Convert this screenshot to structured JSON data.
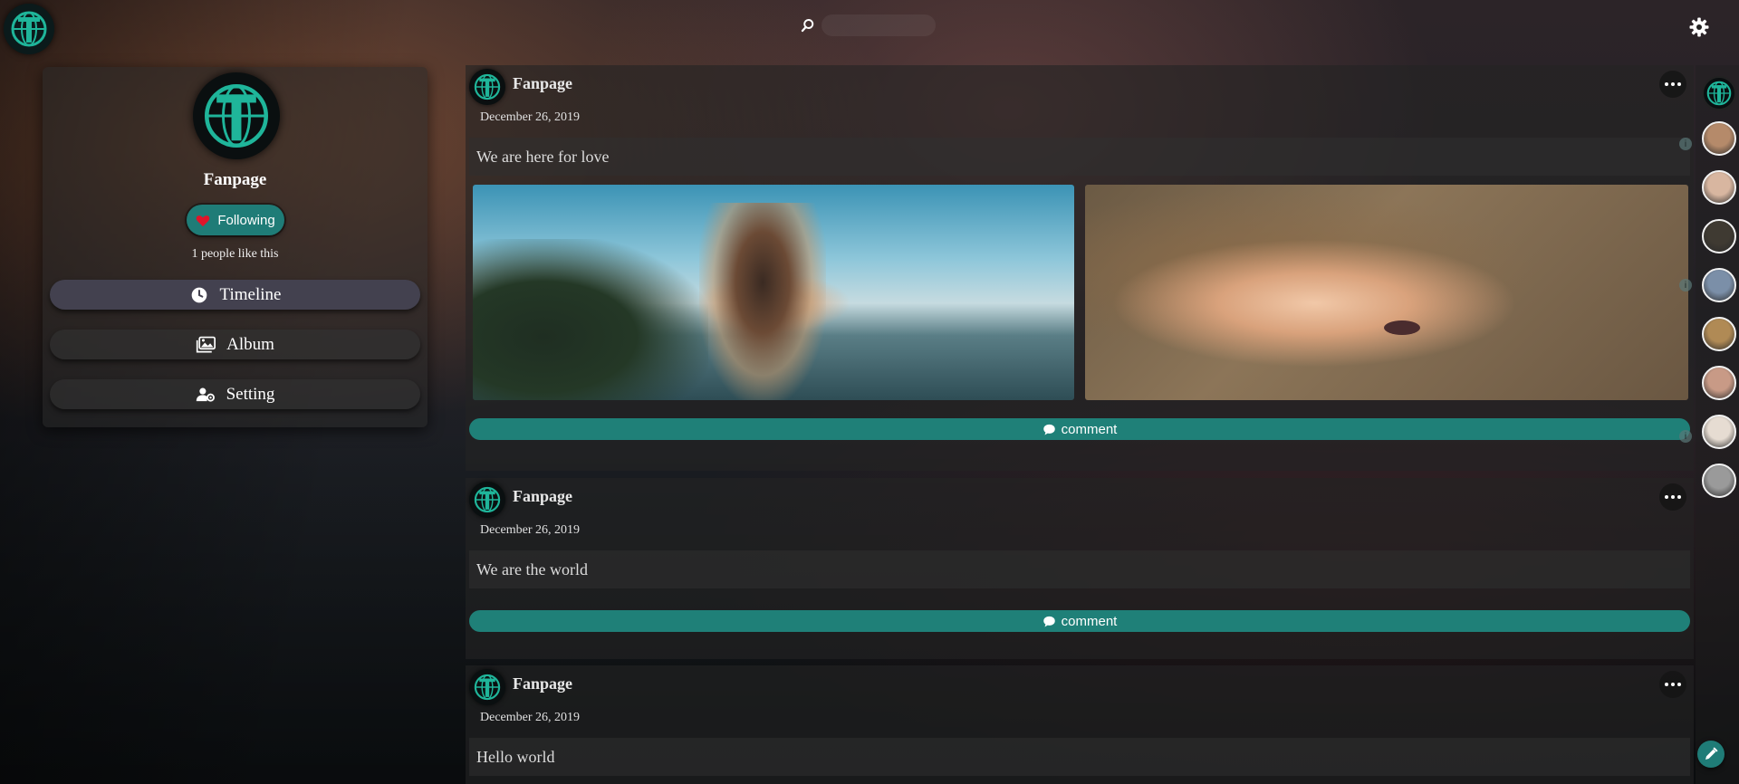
{
  "search": {
    "placeholder": ""
  },
  "profile": {
    "name": "Fanpage",
    "follow_label": "Following",
    "likes_text": "1 people like this"
  },
  "nav": [
    {
      "label": "Timeline",
      "icon": "clock-icon",
      "active": true
    },
    {
      "label": "Album",
      "icon": "images-icon",
      "active": false
    },
    {
      "label": "Setting",
      "icon": "users-cog-icon",
      "active": false
    }
  ],
  "posts": [
    {
      "author": "Fanpage",
      "date": "December 26, 2019",
      "text": "We are here for love",
      "images": 2,
      "comment_label": "comment"
    },
    {
      "author": "Fanpage",
      "date": "December 26, 2019",
      "text": "We are the world",
      "images": 0,
      "comment_label": "comment"
    },
    {
      "author": "Fanpage",
      "date": "December 26, 2019",
      "text": "Hello world",
      "images": 0,
      "comment_label": "comment"
    }
  ],
  "friends": [
    {
      "name": "friend-1",
      "color": "#b58a6a"
    },
    {
      "name": "friend-2",
      "color": "#d8b6a0"
    },
    {
      "name": "friend-3",
      "color": "#3f3a32"
    },
    {
      "name": "friend-4",
      "color": "#7b8fa8"
    },
    {
      "name": "friend-5",
      "color": "#b08a55"
    },
    {
      "name": "friend-6",
      "color": "#c89a86"
    },
    {
      "name": "friend-7",
      "color": "#e6dcd2"
    },
    {
      "name": "friend-8",
      "color": "#9a9a9a"
    }
  ],
  "colors": {
    "accent": "#1f7c77",
    "heart": "#e0142a",
    "logo_teal": "#1fb59a"
  }
}
